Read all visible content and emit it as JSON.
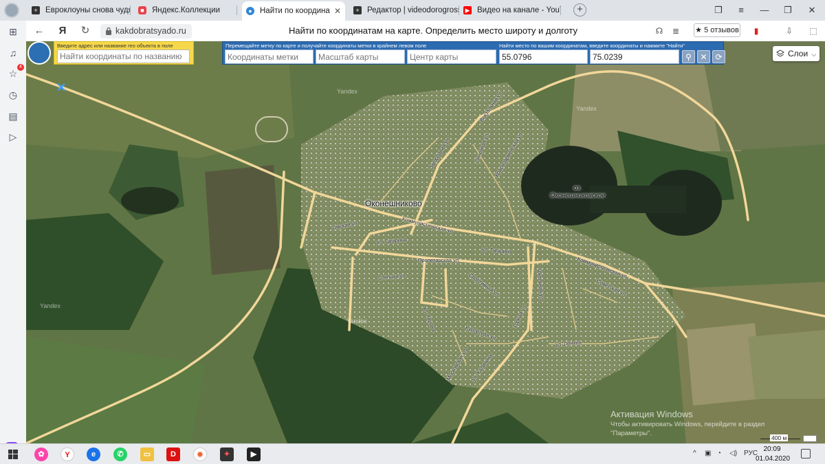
{
  "browser": {
    "tabs": [
      {
        "label": "Евроклоуны снова чудят |",
        "icon": "plus-icon",
        "active": false
      },
      {
        "label": "Яндекс.Коллекции",
        "icon": "collections-icon",
        "active": false
      },
      {
        "label": "Найти по координатам",
        "icon": "globe-icon",
        "active": true
      },
      {
        "label": "Редактор | videodorogross",
        "icon": "plus-icon",
        "active": false
      },
      {
        "label": "Видео на канале - YouTub",
        "icon": "youtube-icon",
        "active": false
      }
    ],
    "url": "kakdobratsyado.ru",
    "page_title": "Найти по координатам на карте. Определить место широту и долготу",
    "reviews_label": "5 отзывов",
    "sidebar_badge": "4"
  },
  "geo_search": {
    "hint": "Введите адрес или название гео объекта в поле",
    "placeholder": "Найти координаты по названию"
  },
  "coords_panel": {
    "hint_left": "Перемещайте метку по карте и получайте координаты метки в крайнем левом поле",
    "hint_right": "Найти место по вашим координатам, введите координаты и нажмите \"Найти\"",
    "marker_placeholder": "Координаты метки",
    "scale_placeholder": "Масштаб карты",
    "center_placeholder": "Центр карты",
    "lat_value": "55.0796",
    "lon_value": "75.0239"
  },
  "map": {
    "layers_label": "Слои",
    "town_label": "Оконешниково",
    "lake_label_1": "оз.",
    "lake_label_2": "Оконешниковское",
    "watermark": "Yandex",
    "scale_label": "400 м",
    "streets": {
      "kommunisticheskaya": "Коммунистическая ул.",
      "kommunisticheskaya_2": "Коммунистическая ул.",
      "proletarskaya": "Пролетарская ул.",
      "gagarina_1": "ул. Гагарина",
      "gagarina_2": "ул. Гагарина",
      "omskaya": "Омская ул.",
      "stepnaya": "Степная ул.",
      "lenina": "ул. Ленина",
      "kirova": "ул. Кирова",
      "sovetskaya": "Советская ул.",
      "zagorodnaya": "Загородная ул.",
      "vokzalnaya": "Вокзальная ул.",
      "lineynaya": "Линейная ул.",
      "krasnoarmeyskaya": "Красноармейская ул.",
      "sportivnaya": "Спортивная ул.",
      "moskovskaya": "Московская ул.",
      "kalinina": "ул. Калинина",
      "kurortnaya": "Курортная ул.",
      "gornaya": "Горная ул.",
      "shkolnaya": "Школьная ул."
    }
  },
  "activation": {
    "line1": "Активация Windows",
    "line2": "Чтобы активировать Windows, перейдите в раздел",
    "line3": "\"Параметры\"."
  },
  "taskbar": {
    "lang": "РУС",
    "time": "20:09",
    "date": "01.04.2020"
  },
  "colors": {
    "coords_panel_bg": "#2d6bb0",
    "geo_box_bg": "#f6d84a",
    "road": "#f2d79a"
  }
}
